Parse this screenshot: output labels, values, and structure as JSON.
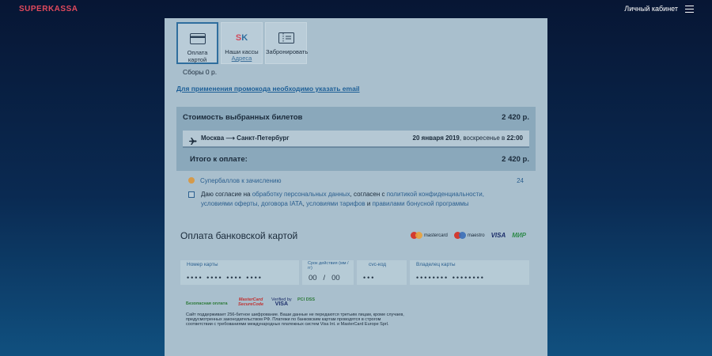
{
  "header": {
    "logo": "SUPERKASSA",
    "account_link": "Личный кабинет"
  },
  "tabs": [
    {
      "label": "Оплата картой",
      "icon": "card-icon"
    },
    {
      "label": "Наши кассы",
      "sublabel": "Адреса",
      "icon": "sk-logo-icon"
    },
    {
      "label": "Забронировать",
      "icon": "ticket-icon"
    }
  ],
  "fees": "Сборы 0 р.",
  "promo_notice": "Для применения промокода необходимо указать email",
  "summary": {
    "selected_title": "Стоимость выбранных билетов",
    "selected_price": "2 420 р.",
    "route": "Москва ⟶ Санкт-Петербург",
    "date_bold": "20 января 2019",
    "date_rest": ", воскресенье в ",
    "time": "22:00",
    "total_title": "Итого к оплате:",
    "total_price": "2 420 р."
  },
  "bonus": {
    "label": "Супербаллов к зачислению",
    "value": "24"
  },
  "consent": {
    "t1": "Даю согласие на ",
    "l1": "обработку персональных данных",
    "t2": ", согласен с ",
    "l2": "политикой конфиденциальности, условиями оферты, договора IATA",
    "t3": ", ",
    "l3": "условиями тарифов",
    "t4": " и ",
    "l4": "правилами бонусной программы"
  },
  "payment": {
    "title": "Оплата банковской картой",
    "brands": [
      "mastercard",
      "maestro",
      "VISA",
      "МИР"
    ],
    "fields": {
      "card_label": "Номер карты",
      "card_placeholder": "•••• •••• •••• ••••",
      "expiry_label": "Срок действия (мм / гг)",
      "expiry_mm": "00",
      "expiry_sep": "/",
      "expiry_yy": "00",
      "cvc_label": "cvc-код",
      "cvc_placeholder": "•••",
      "holder_label": "Владелец карты",
      "holder_placeholder": "•••••••• ••••••••"
    },
    "seals": {
      "safe": "Безопасная оплата",
      "mc1": "MasterCard",
      "mc2": "SecureCode",
      "visa1": "Verified by",
      "visa2": "VISA",
      "pci": "PCI DSS"
    },
    "fine_print": "Сайт поддерживает 256-битное шифрование. Ваши данные не передаются третьим лицам, кроме случаев, предусмотренных законодательством РФ. Платежи по банковским картам проводятся в строгом соответствии с требованиями международных платежных систем Visa Int. и MasterCard Europe Sprl."
  },
  "colors": {
    "background": "#0a2a52",
    "accent": "#2b5f8f",
    "logo": "#e24a5d"
  }
}
